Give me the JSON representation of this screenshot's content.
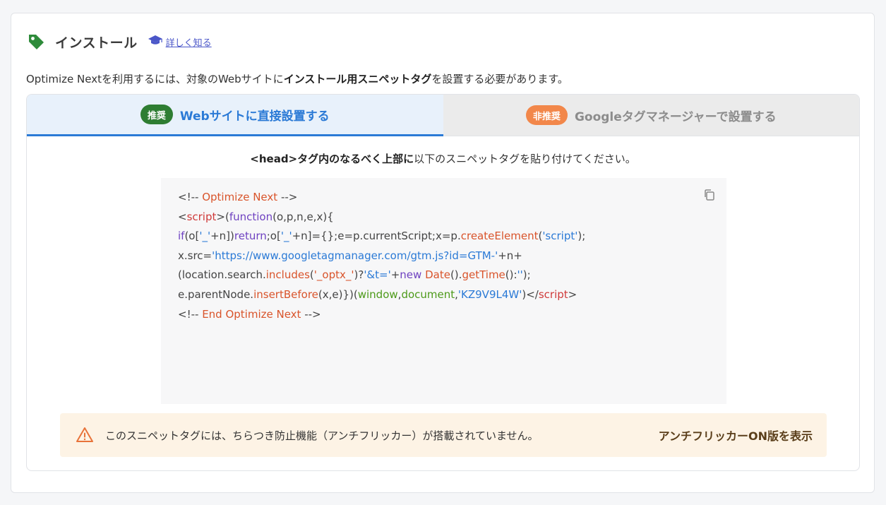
{
  "header": {
    "title": "インストール",
    "learn_more": "詳しく知る",
    "icon": "tag-icon",
    "learn_icon": "graduation-cap-icon"
  },
  "intro": {
    "before": "Optimize Nextを利用するには、対象のWebサイトに",
    "bold": "インストール用スニペットタグ",
    "after": "を設置する必要があります。"
  },
  "tabs": [
    {
      "badge": "推奨",
      "label": "Webサイトに直接設置する",
      "active": true,
      "badge_color": "#2e7d32"
    },
    {
      "badge": "非推奨",
      "label": "Googleタグマネージャーで設置する",
      "active": false,
      "badge_color": "#f2874a"
    }
  ],
  "instruction": {
    "bold": "<head>タグ内のなるべく上部に",
    "rest": "以下のスニペットタグを貼り付けてください。"
  },
  "code": {
    "lines": [
      [
        [
          "<!-- ",
          ""
        ],
        [
          "Optimize Next",
          "fn"
        ],
        [
          " -->",
          ""
        ]
      ],
      [
        [
          "<",
          ""
        ],
        [
          "script",
          "tagc"
        ],
        [
          ">(",
          ""
        ],
        [
          "function",
          "kw"
        ],
        [
          "(o,p,n,e,x){",
          ""
        ]
      ],
      [
        [
          "if",
          "kw"
        ],
        [
          "(o[",
          ""
        ],
        [
          "'_'",
          "str"
        ],
        [
          "+n])",
          ""
        ],
        [
          "return",
          "kw"
        ],
        [
          ";o[",
          ""
        ],
        [
          "'_'",
          "str"
        ],
        [
          "+n]={};e=p.currentScript;x=p.",
          ""
        ],
        [
          "createElement",
          "fn"
        ],
        [
          "(",
          ""
        ],
        [
          "'script'",
          "str"
        ],
        [
          ");",
          ""
        ]
      ],
      [
        [
          "x.src=",
          ""
        ],
        [
          "'https://www.googletagmanager.com/gtm.js?id=GTM-'",
          "str"
        ],
        [
          "+n+",
          ""
        ]
      ],
      [
        [
          "(location.search.",
          ""
        ],
        [
          "includes",
          "fn"
        ],
        [
          "(",
          ""
        ],
        [
          "'_optx_'",
          "fn"
        ],
        [
          ")?",
          ""
        ],
        [
          "'&t='",
          "str"
        ],
        [
          "+",
          ""
        ],
        [
          "new",
          "kw"
        ],
        [
          " ",
          ""
        ],
        [
          "Date",
          "fn"
        ],
        [
          "().",
          ""
        ],
        [
          "getTime",
          "fn"
        ],
        [
          "():",
          ""
        ],
        [
          "''",
          "str"
        ],
        [
          ");",
          ""
        ]
      ],
      [
        [
          "e.parentNode.",
          ""
        ],
        [
          "insertBefore",
          "fn"
        ],
        [
          "(x,e)})(",
          ""
        ],
        [
          "window",
          "grn"
        ],
        [
          ",",
          ""
        ],
        [
          "document",
          "grn"
        ],
        [
          ",",
          ""
        ],
        [
          "'KZ9V9L4W'",
          "str"
        ],
        [
          ")</",
          ""
        ],
        [
          "script",
          "tagc"
        ],
        [
          ">",
          ""
        ]
      ],
      [
        [
          "<!-- ",
          ""
        ],
        [
          "End Optimize Next",
          "fn"
        ],
        [
          " -->",
          ""
        ]
      ]
    ],
    "copy_icon": "copy-icon"
  },
  "alert": {
    "icon": "warning-icon",
    "text": "このスニペットタグには、ちらつき防止機能（アンチフリッカー）が搭載されていません。",
    "action": "アンチフリッカーON版を表示"
  },
  "colors": {
    "accent": "#2b7ad6",
    "green": "#2e7d32",
    "orange": "#f2874a",
    "alert_bg": "#fdf3e5"
  }
}
